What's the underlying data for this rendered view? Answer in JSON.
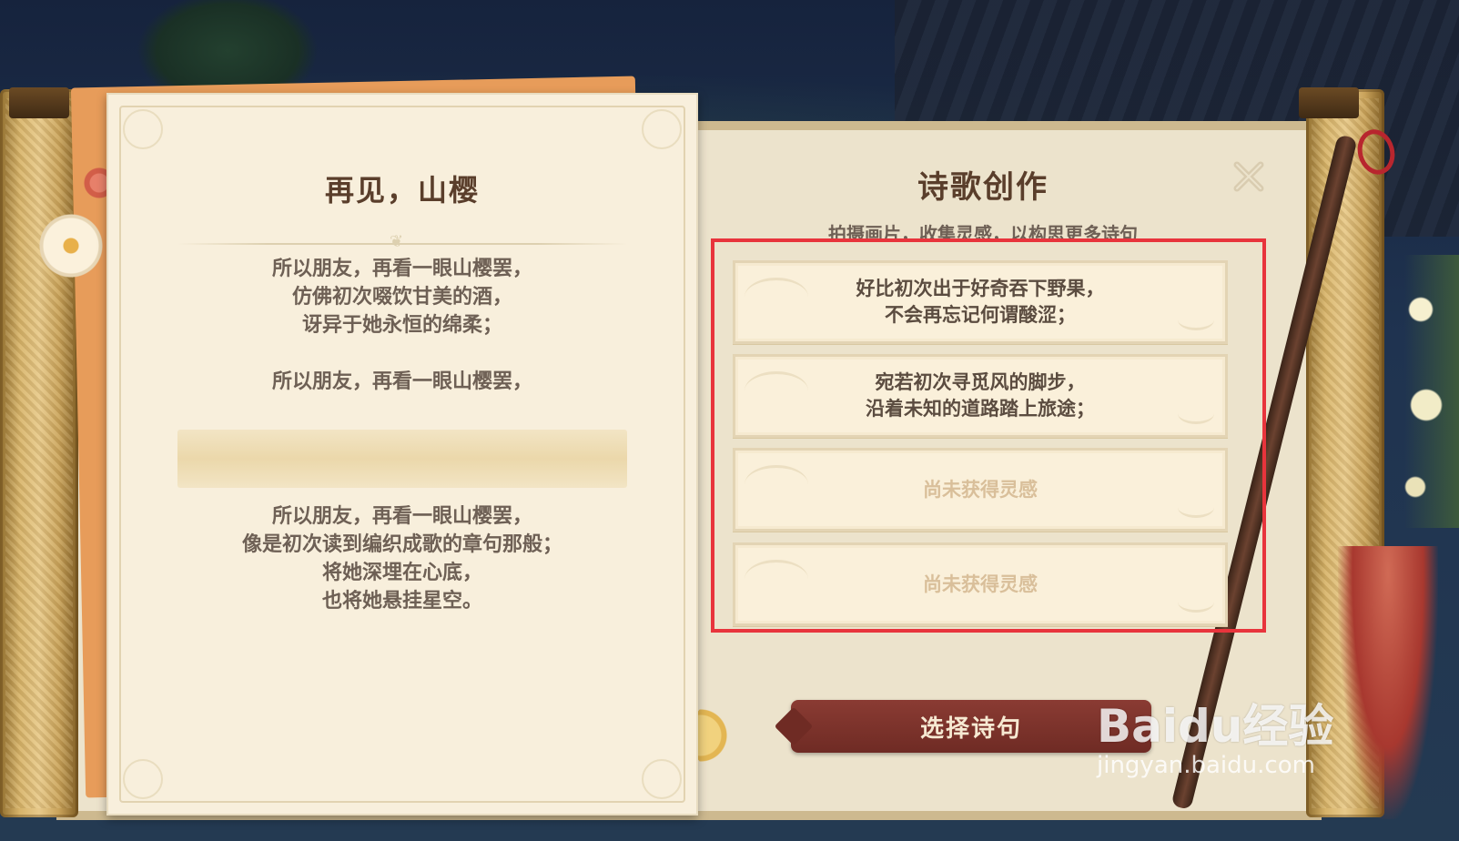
{
  "poem": {
    "title": "再见，山樱",
    "stanza1": [
      "所以朋友，再看一眼山樱罢，",
      "仿佛初次啜饮甘美的酒，",
      "讶异于她永恒的绵柔；"
    ],
    "stanza2": [
      "所以朋友，再看一眼山樱罢，"
    ],
    "stanza3": [
      "所以朋友，再看一眼山樱罢，",
      "像是初次读到编织成歌的章句那般；",
      "将她深埋在心底，",
      "也将她悬挂星空。"
    ]
  },
  "panel": {
    "title": "诗歌创作",
    "subtitle": "拍摄画片，收集灵感，以构思更多诗句",
    "options": [
      {
        "lines": [
          "好比初次出于好奇吞下野果，",
          "不会再忘记何谓酸涩；"
        ],
        "locked": false
      },
      {
        "lines": [
          "宛若初次寻觅风的脚步，",
          "沿着未知的道路踏上旅途；"
        ],
        "locked": false
      },
      {
        "lines": [
          "尚未获得灵感"
        ],
        "locked": true
      },
      {
        "lines": [
          "尚未获得灵感"
        ],
        "locked": true
      }
    ],
    "select_button": "选择诗句"
  },
  "watermark": {
    "main": "Baidu经验",
    "sub": "jingyan.baidu.com"
  },
  "colors": {
    "highlight": "#e8343c",
    "button": "#7a3029",
    "title_text": "#5a3e2b",
    "locked_text": "#d9bf9a"
  },
  "icons": {
    "close": "close-icon",
    "flower": "sakura-flower-icon"
  }
}
